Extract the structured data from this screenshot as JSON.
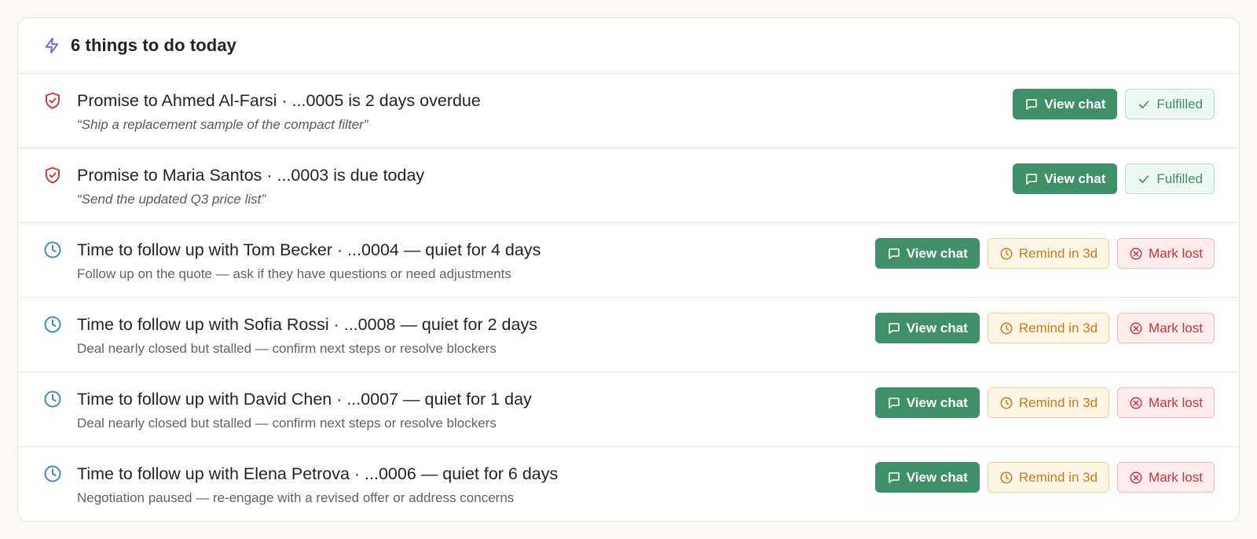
{
  "header": {
    "icon": "lightning-icon",
    "title": "6 things to do today",
    "accent_color": "#7b5cf0"
  },
  "colors": {
    "primary_green": "#3f8f69",
    "promise_red": "#d23b3b",
    "clock_blue": "#3d8fb8",
    "remind_amber": "#c97a16",
    "lost_red": "#c8343a"
  },
  "items": [
    {
      "type": "promise",
      "icon": "shield-check-icon",
      "title": "Promise to Ahmed Al-Farsi · ...0005 is 2 days overdue",
      "subtitle": "“Ship a replacement sample of the compact filter”",
      "view_chat": "View chat",
      "fulfilled": "Fulfilled"
    },
    {
      "type": "promise",
      "icon": "shield-check-icon",
      "title": "Promise to Maria Santos · ...0003 is due today",
      "subtitle": "“Send the updated Q3 price list”",
      "view_chat": "View chat",
      "fulfilled": "Fulfilled"
    },
    {
      "type": "followup",
      "icon": "clock-icon",
      "title": "Time to follow up with Tom Becker · ...0004 — quiet for 4 days",
      "subtitle": "Follow up on the quote — ask if they have questions or need adjustments",
      "view_chat": "View chat",
      "remind": "Remind in 3d",
      "mark_lost": "Mark lost"
    },
    {
      "type": "followup",
      "icon": "clock-icon",
      "title": "Time to follow up with Sofia Rossi · ...0008 — quiet for 2 days",
      "subtitle": "Deal nearly closed but stalled — confirm next steps or resolve blockers",
      "view_chat": "View chat",
      "remind": "Remind in 3d",
      "mark_lost": "Mark lost"
    },
    {
      "type": "followup",
      "icon": "clock-icon",
      "title": "Time to follow up with David Chen · ...0007 — quiet for 1 day",
      "subtitle": "Deal nearly closed but stalled — confirm next steps or resolve blockers",
      "view_chat": "View chat",
      "remind": "Remind in 3d",
      "mark_lost": "Mark lost"
    },
    {
      "type": "followup",
      "icon": "clock-icon",
      "title": "Time to follow up with Elena Petrova · ...0006 — quiet for 6 days",
      "subtitle": "Negotiation paused — re-engage with a revised offer or address concerns",
      "view_chat": "View chat",
      "remind": "Remind in 3d",
      "mark_lost": "Mark lost"
    }
  ]
}
